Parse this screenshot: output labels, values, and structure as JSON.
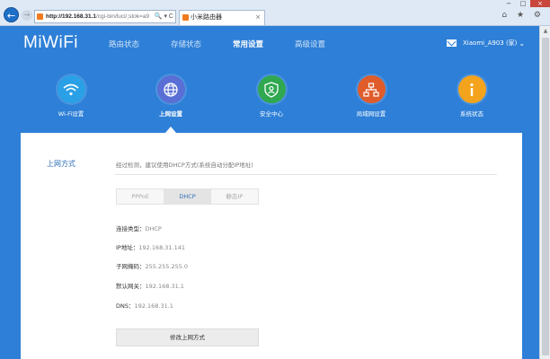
{
  "browser": {
    "address_host": "http://192.168.31.1",
    "address_path": "/cgi-bin/luci/;stok=a9",
    "address_icons": "🔍 ▾ C",
    "tab_title": "小米路由器",
    "tab_close": "×",
    "window_controls": [
      "−",
      "□",
      "×"
    ],
    "toolbar_icons": "⌂ ★ ⚙"
  },
  "logo": "MiWiFi",
  "topnav": [
    {
      "label": "路由状态",
      "active": false
    },
    {
      "label": "存储状态",
      "active": false
    },
    {
      "label": "常用设置",
      "active": true
    },
    {
      "label": "高级设置",
      "active": false
    }
  ],
  "user": {
    "name": "Xiaomi_A903 (家)",
    "caret": "⌄"
  },
  "functions": [
    {
      "label": "Wi-Fi设置",
      "icon": "wifi-icon",
      "color": "#2aa0e6",
      "active": false
    },
    {
      "label": "上网设置",
      "icon": "globe-icon",
      "color": "#5a6fd6",
      "active": true
    },
    {
      "label": "安全中心",
      "icon": "shield-user-icon",
      "color": "#2fa84f",
      "active": false
    },
    {
      "label": "局域网设置",
      "icon": "network-icon",
      "color": "#e05c2b",
      "active": false
    },
    {
      "label": "系统状态",
      "icon": "info-icon",
      "color": "#f4a41c",
      "active": false
    }
  ],
  "panel": {
    "section_title": "上网方式",
    "description": "经过检测，建议使用DHCP方式(系统自动分配IP地址)",
    "modes": [
      {
        "label": "PPPoE",
        "active": false
      },
      {
        "label": "DHCP",
        "active": true
      },
      {
        "label": "静态IP",
        "active": false
      }
    ],
    "info": [
      {
        "label": "连接类型：",
        "value": "DHCP"
      },
      {
        "label": "IP地址：",
        "value": "192.168.31.141"
      },
      {
        "label": "子网掩码：",
        "value": "255.255.255.0"
      },
      {
        "label": "默认网关：",
        "value": "192.168.31.1"
      },
      {
        "label": "DNS：",
        "value": "192.168.31.1"
      }
    ],
    "modify_button": "修改上网方式"
  }
}
